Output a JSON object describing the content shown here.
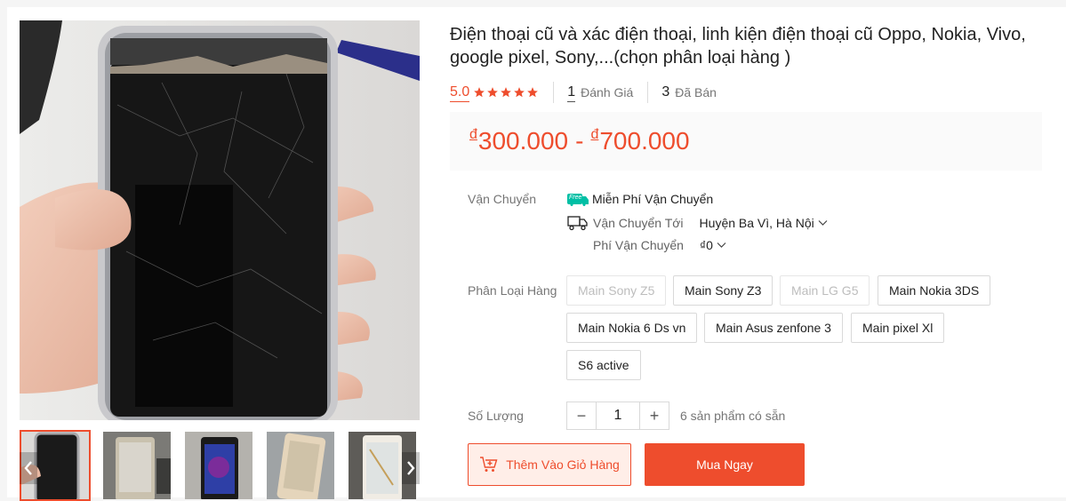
{
  "product": {
    "title": "Điện thoại cũ và xác điện thoại, linh kiện điện thoại cũ Oppo, Nokia, Vivo, google pixel, Sony,...(chọn phân loại hàng )"
  },
  "stats": {
    "rating": "5.0",
    "stars": 5,
    "reviews_count": "1",
    "reviews_label": "Đánh Giá",
    "sold_count": "3",
    "sold_label": "Đã Bán"
  },
  "price": {
    "currency": "đ",
    "min": "300.000",
    "separator": "-",
    "max": "700.000"
  },
  "shipping": {
    "label": "Vận Chuyển",
    "free_badge": "Free",
    "free_text": "Miễn Phí Vận Chuyển",
    "to_label": "Vận Chuyển Tới",
    "to_value": "Huyện Ba Vì, Hà Nội",
    "fee_label": "Phí Vận Chuyển",
    "fee_value": "₫0"
  },
  "variants": {
    "label": "Phân Loại Hàng",
    "options": [
      {
        "label": "Main Sony Z5",
        "disabled": true
      },
      {
        "label": "Main Sony Z3",
        "disabled": false
      },
      {
        "label": "Main LG G5",
        "disabled": true
      },
      {
        "label": "Main Nokia 3DS",
        "disabled": false
      },
      {
        "label": "Main Nokia 6 Ds vn",
        "disabled": false
      },
      {
        "label": "Main Asus zenfone 3",
        "disabled": false
      },
      {
        "label": "Main pixel Xl",
        "disabled": false
      },
      {
        "label": "S6 active",
        "disabled": false
      }
    ]
  },
  "quantity": {
    "label": "Số Lượng",
    "value": "1",
    "minus": "−",
    "plus": "+",
    "stock_text": "6 sản phẩm có sẵn"
  },
  "actions": {
    "add_to_cart": "Thêm Vào Giỏ Hàng",
    "buy_now": "Mua Ngay"
  },
  "colors": {
    "accent": "#ee4d2d",
    "accent_light": "#ffeee8",
    "free_badge": "#00bfa5"
  },
  "icons": {
    "star": "star-icon",
    "truck": "truck-icon",
    "cart": "cart-add-icon",
    "chevron": "chevron-down-icon"
  }
}
